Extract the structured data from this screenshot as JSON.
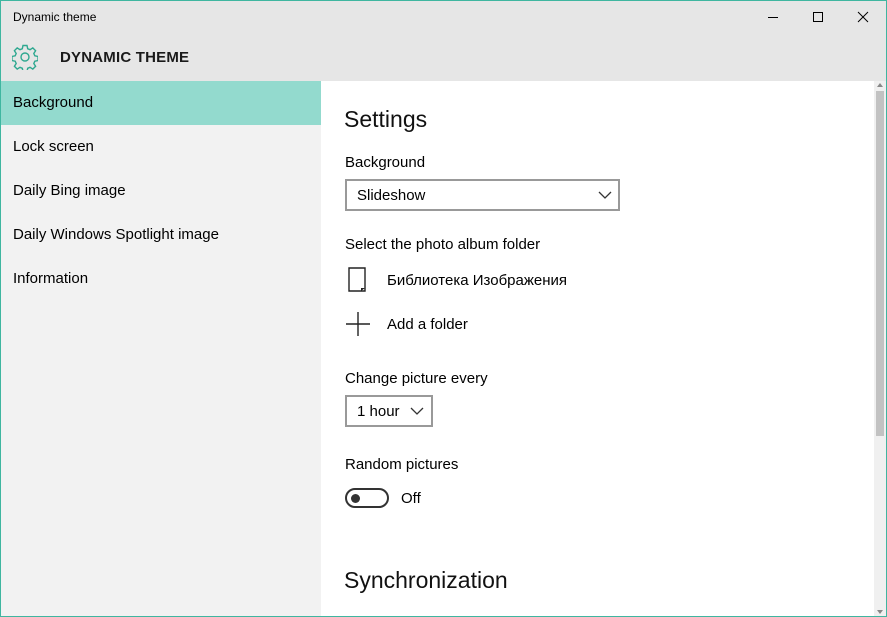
{
  "window": {
    "title": "Dynamic theme",
    "accent": "#3fb6a0"
  },
  "header": {
    "app_title": "DYNAMIC THEME",
    "icon": "gear-icon"
  },
  "sidebar": {
    "items": [
      {
        "label": "Background",
        "active": true
      },
      {
        "label": "Lock screen",
        "active": false
      },
      {
        "label": "Daily Bing image",
        "active": false
      },
      {
        "label": "Daily Windows Spotlight image",
        "active": false
      },
      {
        "label": "Information",
        "active": false
      }
    ],
    "active_color": "#93dace"
  },
  "settings": {
    "heading": "Settings",
    "background": {
      "label": "Background",
      "value": "Slideshow"
    },
    "album": {
      "label": "Select the photo album folder",
      "folder_name": "Библиотека Изображения",
      "add_label": "Add a folder"
    },
    "interval": {
      "label": "Change picture every",
      "value": "1 hour"
    },
    "random": {
      "label": "Random pictures",
      "state": "Off"
    }
  },
  "sync": {
    "heading": "Synchronization"
  }
}
